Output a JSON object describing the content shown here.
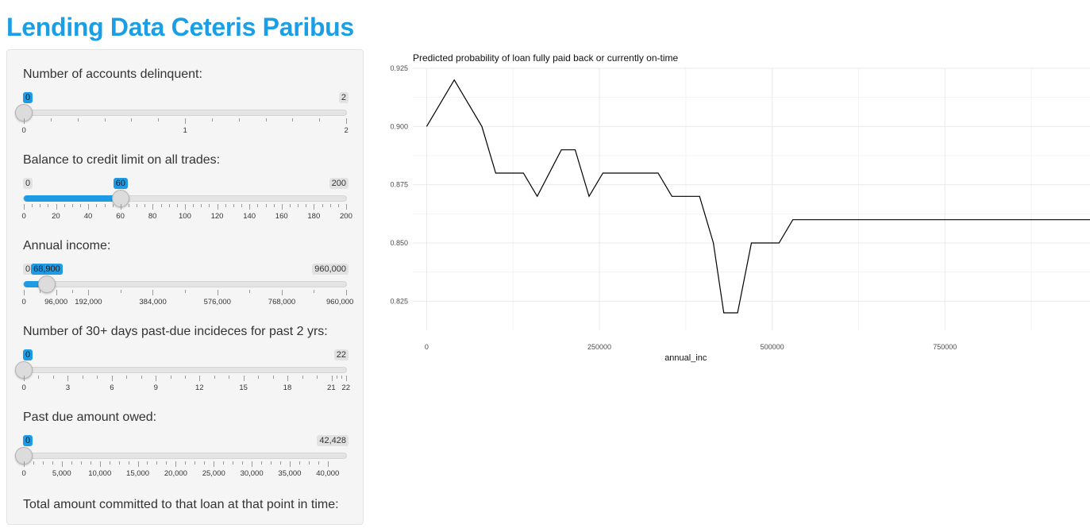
{
  "page": {
    "title": "Lending Data Ceteris Paribus"
  },
  "sliders": [
    {
      "id": "acc-now-delinq",
      "label": "Number of accounts delinquent:",
      "min_label": "0",
      "max_label": "2",
      "value_label": "0",
      "min": 0,
      "max": 2,
      "value": 0,
      "ticks": [
        0,
        1,
        2
      ],
      "minor": 5,
      "tick_labels": [
        "0",
        "1",
        "2"
      ],
      "hide_min_badge": true,
      "hide_max_badge": false
    },
    {
      "id": "revol-util",
      "label": "Balance to credit limit on all trades:",
      "min_label": "0",
      "max_label": "200",
      "value_label": "60",
      "min": 0,
      "max": 200,
      "value": 60,
      "ticks": [
        0,
        20,
        40,
        60,
        80,
        100,
        120,
        140,
        160,
        180,
        200
      ],
      "minor": 3,
      "tick_labels": [
        "0",
        "20",
        "40",
        "60",
        "80",
        "100",
        "120",
        "140",
        "160",
        "180",
        "200"
      ],
      "hide_min_badge": false,
      "hide_max_badge": false
    },
    {
      "id": "annual-inc",
      "label": "Annual income:",
      "min_label": "0",
      "max_label": "960,000",
      "value_label": "68,900",
      "min": 0,
      "max": 960000,
      "value": 68900,
      "ticks": [
        0,
        96000,
        192000,
        384000,
        576000,
        768000,
        960000
      ],
      "minor": 1,
      "tick_labels": [
        "0",
        "96,000",
        "192,000",
        "384,000",
        "576,000",
        "768,000",
        "960,000"
      ],
      "hide_min_badge": false,
      "hide_max_badge": false
    },
    {
      "id": "delinq-2yrs",
      "label": "Number of 30+ days past-due incideces for past 2 yrs:",
      "min_label": "0",
      "max_label": "22",
      "value_label": "0",
      "min": 0,
      "max": 22,
      "value": 0,
      "ticks": [
        0,
        3,
        6,
        9,
        12,
        15,
        18,
        21,
        22
      ],
      "minor": 2,
      "tick_labels": [
        "0",
        "3",
        "6",
        "9",
        "12",
        "15",
        "18",
        "21",
        "22"
      ],
      "hide_min_badge": true,
      "hide_max_badge": false
    },
    {
      "id": "delinq-amnt",
      "label": "Past due amount owed:",
      "min_label": "0",
      "max_label": "42,428",
      "value_label": "0",
      "min": 0,
      "max": 42428,
      "value": 0,
      "ticks": [
        0,
        5000,
        10000,
        15000,
        20000,
        25000,
        30000,
        35000,
        40000
      ],
      "minor": 3,
      "tick_labels": [
        "0",
        "5,000",
        "10,000",
        "15,000",
        "20,000",
        "25,000",
        "30,000",
        "35,000",
        "40,000"
      ],
      "hide_min_badge": true,
      "hide_max_badge": false
    }
  ],
  "sidebar_footer": {
    "label": "Total amount committed to that loan at that point in time:"
  },
  "chart_data": {
    "type": "line",
    "title": "Predicted probability of loan fully paid back or currently on-time",
    "xlabel": "annual_inc",
    "ylabel": "",
    "xlim": [
      -20000,
      960000
    ],
    "ylim": [
      0.8125,
      0.925
    ],
    "x_ticks": [
      0,
      250000,
      500000,
      750000
    ],
    "x_tick_labels": [
      "0",
      "250000",
      "500000",
      "750000"
    ],
    "y_ticks": [
      0.825,
      0.85,
      0.875,
      0.9,
      0.925
    ],
    "y_tick_labels": [
      "0.825",
      "0.850",
      "0.875",
      "0.900",
      "0.925"
    ],
    "grid": true,
    "line_color": "#000000",
    "series": [
      {
        "name": "",
        "x": [
          0,
          40000,
          80000,
          100000,
          140000,
          160000,
          195000,
          215000,
          235000,
          255000,
          300000,
          335000,
          355000,
          395000,
          415000,
          430000,
          450000,
          470000,
          510000,
          530000,
          960000
        ],
        "y": [
          0.9,
          0.92,
          0.9,
          0.88,
          0.88,
          0.87,
          0.89,
          0.89,
          0.87,
          0.88,
          0.88,
          0.88,
          0.87,
          0.87,
          0.85,
          0.82,
          0.82,
          0.85,
          0.85,
          0.86,
          0.86
        ]
      }
    ]
  }
}
